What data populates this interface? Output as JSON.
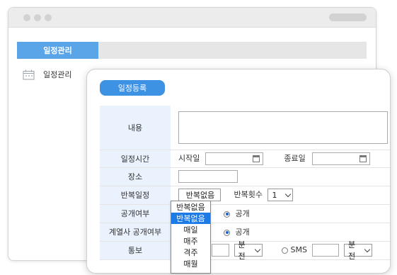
{
  "back_window": {
    "tab_label": "일정관리",
    "menu_item_label": "일정관리"
  },
  "dialog": {
    "title": "일정등록",
    "rows": {
      "content": {
        "label": "내용",
        "value": ""
      },
      "schedule_time": {
        "label": "일정시간",
        "start_label": "시작일",
        "start_value": "",
        "end_label": "종료일",
        "end_value": ""
      },
      "place": {
        "label": "장소",
        "value": ""
      },
      "repeat": {
        "label": "반복일정",
        "selected": "반복없음",
        "count_label": "반복횟수",
        "count_value": "1"
      },
      "public": {
        "label": "공개여부",
        "option_label": "공개",
        "checked": true
      },
      "affiliate_public": {
        "label": "계열사 공개여부",
        "option_label": "공개",
        "checked": true
      },
      "notify": {
        "label": "통보",
        "select1_value": "분전",
        "sms_label": "SMS",
        "sms_value": "",
        "select2_value": "분전"
      }
    },
    "repeat_dropdown": {
      "options": [
        "반복없음",
        "반복없음",
        "매일",
        "매주",
        "격주",
        "매월"
      ],
      "highlighted_index": 1
    }
  }
}
